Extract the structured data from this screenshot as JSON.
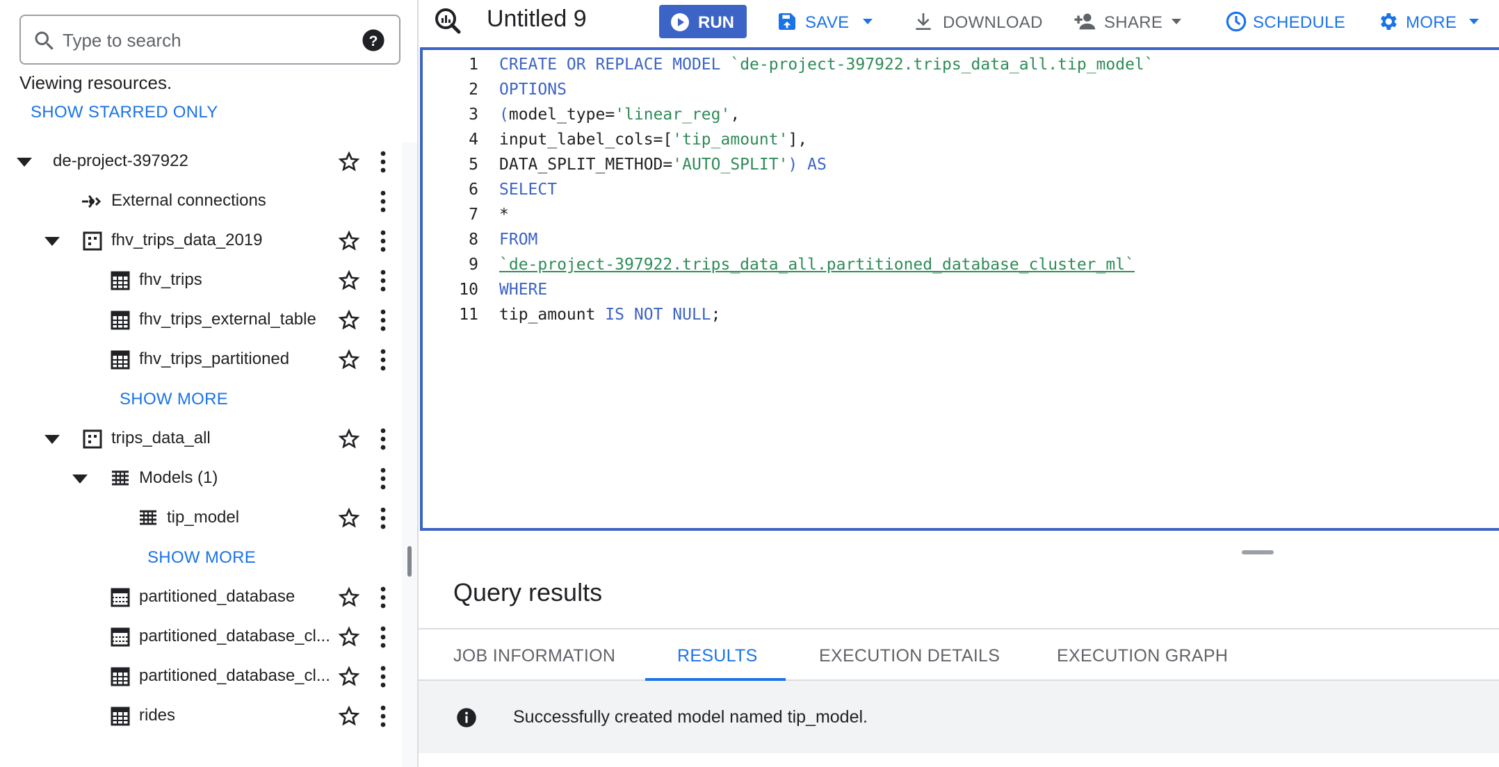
{
  "search": {
    "placeholder": "Type to search"
  },
  "explorer": {
    "viewing_text": "Viewing resources.",
    "show_starred_label": "SHOW STARRED ONLY",
    "project": "de-project-397922",
    "external_connections": "External connections",
    "datasets": [
      {
        "name": "fhv_trips_data_2019",
        "tables": [
          "fhv_trips",
          "fhv_trips_external_table",
          "fhv_trips_partitioned"
        ],
        "show_more": "SHOW MORE"
      },
      {
        "name": "trips_data_all",
        "models_folder": "Models (1)",
        "models": [
          "tip_model"
        ],
        "show_more": "SHOW MORE",
        "tables": [
          "partitioned_database",
          "partitioned_database_cl...",
          "partitioned_database_cl...",
          "rides"
        ]
      }
    ]
  },
  "toolbar": {
    "tab_title": "Untitled 9",
    "run_label": "RUN",
    "save_label": "SAVE",
    "download_label": "DOWNLOAD",
    "share_label": "SHARE",
    "schedule_label": "SCHEDULE",
    "more_label": "MORE"
  },
  "editor": {
    "line_numbers": [
      "1",
      "2",
      "3",
      "4",
      "5",
      "6",
      "7",
      "8",
      "9",
      "10",
      "11"
    ],
    "lines": [
      [
        {
          "t": "CREATE OR REPLACE MODEL ",
          "c": "kw"
        },
        {
          "t": "`de-project-397922.trips_data_all.tip_model`",
          "c": "str"
        }
      ],
      [
        {
          "t": "OPTIONS",
          "c": "kw"
        }
      ],
      [
        {
          "t": "(",
          "c": "kw"
        },
        {
          "t": "model_type=",
          "c": "plain"
        },
        {
          "t": "'linear_reg'",
          "c": "str"
        },
        {
          "t": ",",
          "c": "plain"
        }
      ],
      [
        {
          "t": "input_label_cols=",
          "c": "plain"
        },
        {
          "t": "[",
          "c": "plain"
        },
        {
          "t": "'tip_amount'",
          "c": "str"
        },
        {
          "t": "],",
          "c": "plain"
        }
      ],
      [
        {
          "t": "DATA_SPLIT_METHOD=",
          "c": "plain"
        },
        {
          "t": "'AUTO_SPLIT'",
          "c": "str"
        },
        {
          "t": ") AS",
          "c": "kw"
        }
      ],
      [
        {
          "t": "SELECT",
          "c": "kw"
        }
      ],
      [
        {
          "t": "*",
          "c": "plain"
        }
      ],
      [
        {
          "t": "FROM",
          "c": "kw"
        }
      ],
      [
        {
          "t": "`de-project-397922.trips_data_all.partitioned_database_cluster_ml`",
          "c": "link"
        }
      ],
      [
        {
          "t": "WHERE",
          "c": "kw"
        }
      ],
      [
        {
          "t": "tip_amount ",
          "c": "plain"
        },
        {
          "t": "IS NOT NULL",
          "c": "kw"
        },
        {
          "t": ";",
          "c": "plain"
        }
      ]
    ]
  },
  "results": {
    "title": "Query results",
    "tabs": [
      "JOB INFORMATION",
      "RESULTS",
      "EXECUTION DETAILS",
      "EXECUTION GRAPH"
    ],
    "active_tab": "RESULTS",
    "message": "Successfully created model named tip_model."
  },
  "colors": {
    "accent": "#1a73e8",
    "run_button": "#3c63c6",
    "keyword": "#3c63c6",
    "string": "#2e8b57"
  },
  "icons": [
    "search-icon",
    "help-icon",
    "caret-down-icon",
    "external-connection-icon",
    "dataset-icon",
    "table-icon",
    "model-icon",
    "star-icon",
    "kebab-icon",
    "bigquery-icon",
    "play-icon",
    "save-icon",
    "download-icon",
    "share-icon",
    "schedule-icon",
    "gear-icon",
    "info-icon"
  ]
}
